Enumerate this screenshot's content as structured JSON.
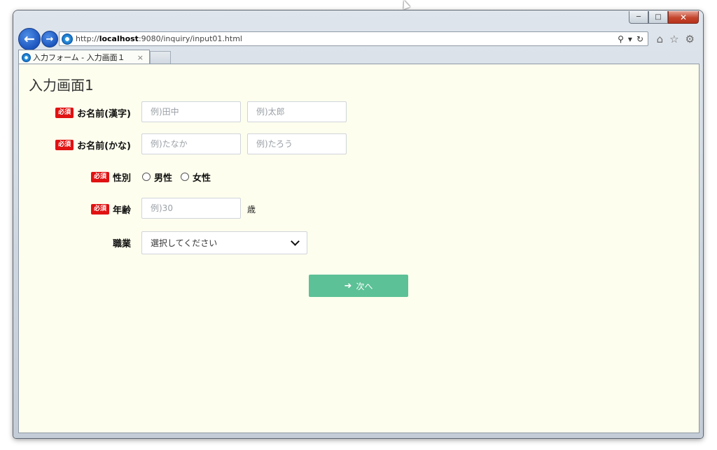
{
  "browser": {
    "url_scheme": "http://",
    "url_host": "localhost",
    "url_path": ":9080/inquiry/input01.html",
    "tab_title": "入力フォーム - 入力画面１",
    "tab_close": "×"
  },
  "page": {
    "title": "入力画面1"
  },
  "form": {
    "required_badge": "必須",
    "name_kanji": {
      "label": "お名前(漢字)",
      "last_placeholder": "例)田中",
      "first_placeholder": "例)太郎"
    },
    "name_kana": {
      "label": "お名前(かな)",
      "last_placeholder": "例)たなか",
      "first_placeholder": "例)たろう"
    },
    "gender": {
      "label": "性別",
      "options": [
        "男性",
        "女性"
      ]
    },
    "age": {
      "label": "年齢",
      "placeholder": "例)30",
      "unit": "歳"
    },
    "occupation": {
      "label": "職業",
      "selected": "選択してください"
    },
    "next_button": "次へ"
  },
  "colors": {
    "page_background": "#fefeee",
    "required_badge": "#e01212",
    "next_button": "#5cc196"
  },
  "icons": [
    "back-arrow-icon",
    "forward-arrow-icon",
    "ie-page-icon",
    "search-icon",
    "refresh-icon",
    "home-icon",
    "favorites-star-icon",
    "settings-gear-icon",
    "chevron-down-icon",
    "arrow-right-icon"
  ]
}
